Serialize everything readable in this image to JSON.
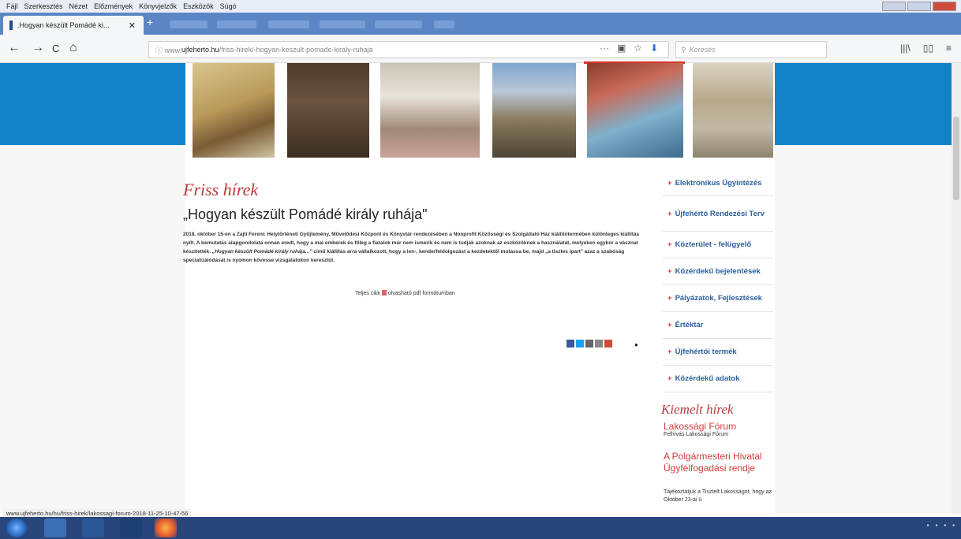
{
  "menubar": {
    "items": [
      "Fájl",
      "Szerkesztés",
      "Nézet",
      "Előzmények",
      "Könyvjelzők",
      "Eszközök",
      "Súgó"
    ]
  },
  "tab": {
    "title": ".Hogyan készült Pomádé ki...",
    "close": "✕",
    "new": "+"
  },
  "nav": {
    "back": "←",
    "forward": "→",
    "reload": "C",
    "home": "⌂",
    "url_prefix": "ⓘ www.",
    "url_domain": "ujfeherto.hu",
    "url_rest": "/friss-hirek/-hogyan-keszult-pomade-kiraly-ruhaja",
    "url_icons": [
      "···",
      "▣",
      "☆",
      "⬇"
    ],
    "search_placeholder": "Keresés",
    "right_icons": [
      "|||\\",
      "▯▯",
      "≡"
    ]
  },
  "content": {
    "section_heading": "Friss hírek",
    "article_title": "„Hogyan készült Pomádé király ruhája\"",
    "article_body_1": "2018. október 15-én a Zajti Ferenc Helytörténeti Gyűjtemény, Művelődési Központ és Könyvtár rendezésében a Nonprofit Közösségi és Szolgáltató Ház kiállítótermében különleges kiállítás nyílt. A bemutatás alapgondolata onnan eredt, hogy a mai emberek és főleg a fiatalok már nem ismerik és nem is tudják azoknak az eszközöknek a használatát, melyeken egykor a vásznat készítették.",
    "article_body_italic": "„Hogyan készült Pomádé király ruhája...\"",
    "article_body_2": " című kiállítás arra vállalkozott, hogy a len-, kenderfeldolgozást a kezdetektől mutassa be, majd „a tisztes ipart\" azaz a szabóság specializálódását is nyomon kövesse vizsgálatokon keresztül.",
    "fulltext_before": "Teljes cikk",
    "fulltext_after": " olvasható pdf formátumban",
    "share_more": "+"
  },
  "sidebar": {
    "items": [
      "Elektronikus Ügyintézés",
      "Újfehértó Rendezési Terv",
      "Közterület - felügyelő",
      "Közérdekű bejelentések",
      "Pályázatok, Fejlesztések",
      "Értéktár",
      "Újfehértói termék",
      "Közérdekű adatok"
    ],
    "featured_heading": "Kiemelt hírek",
    "featured": [
      {
        "title": "Lakossági Fórum",
        "desc": "Felhívás Lakossági Fórum"
      },
      {
        "title": "A Polgármesteri Hivatal Ügyfélfogadási rendje",
        "desc": "Tájékoztatjuk a Tisztelt Lakosságot, hogy az Október 23-ai ü"
      }
    ]
  },
  "status": {
    "url": "www.ujfeherto.hu/hu/friss-hirek/lakossagi-forum-2018-11-25-10-47-56"
  },
  "colors": {
    "brand_blue": "#1383c9",
    "heading_red": "#b93a3a",
    "link_blue": "#2a5f9e"
  }
}
